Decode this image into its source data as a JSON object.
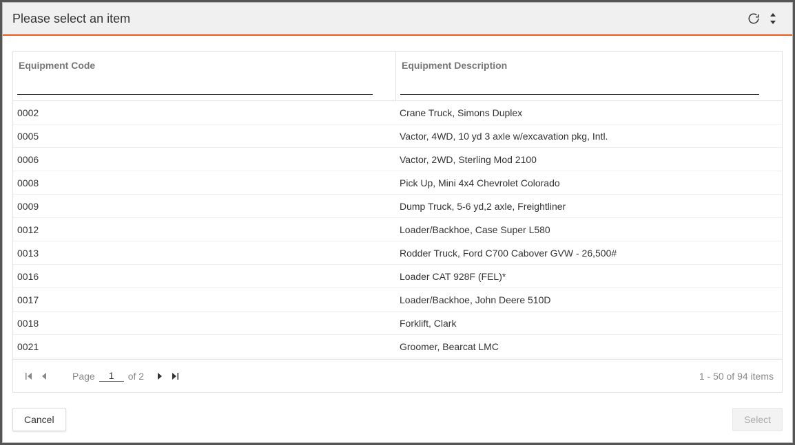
{
  "header": {
    "title": "Please select an item"
  },
  "columns": {
    "code": "Equipment Code",
    "desc": "Equipment Description"
  },
  "rows": [
    {
      "code": "0002",
      "desc": "Crane Truck, Simons Duplex"
    },
    {
      "code": "0005",
      "desc": "Vactor, 4WD, 10 yd 3 axle w/excavation pkg, Intl."
    },
    {
      "code": "0006",
      "desc": "Vactor, 2WD, Sterling Mod 2100"
    },
    {
      "code": "0008",
      "desc": "Pick Up, Mini 4x4 Chevrolet Colorado"
    },
    {
      "code": "0009",
      "desc": "Dump Truck, 5-6 yd,2 axle, Freightliner"
    },
    {
      "code": "0012",
      "desc": "Loader/Backhoe, Case Super L580"
    },
    {
      "code": "0013",
      "desc": "Rodder Truck, Ford C700 Cabover GVW - 26,500#"
    },
    {
      "code": "0016",
      "desc": "Loader CAT 928F (FEL)*"
    },
    {
      "code": "0017",
      "desc": "Loader/Backhoe, John Deere 510D"
    },
    {
      "code": "0018",
      "desc": "Forklift, Clark"
    },
    {
      "code": "0021",
      "desc": "Groomer, Bearcat LMC"
    }
  ],
  "pager": {
    "page_label": "Page",
    "current_page": "1",
    "of_label": "of 2",
    "summary": "1 - 50 of 94 items"
  },
  "footer": {
    "cancel": "Cancel",
    "select": "Select"
  }
}
